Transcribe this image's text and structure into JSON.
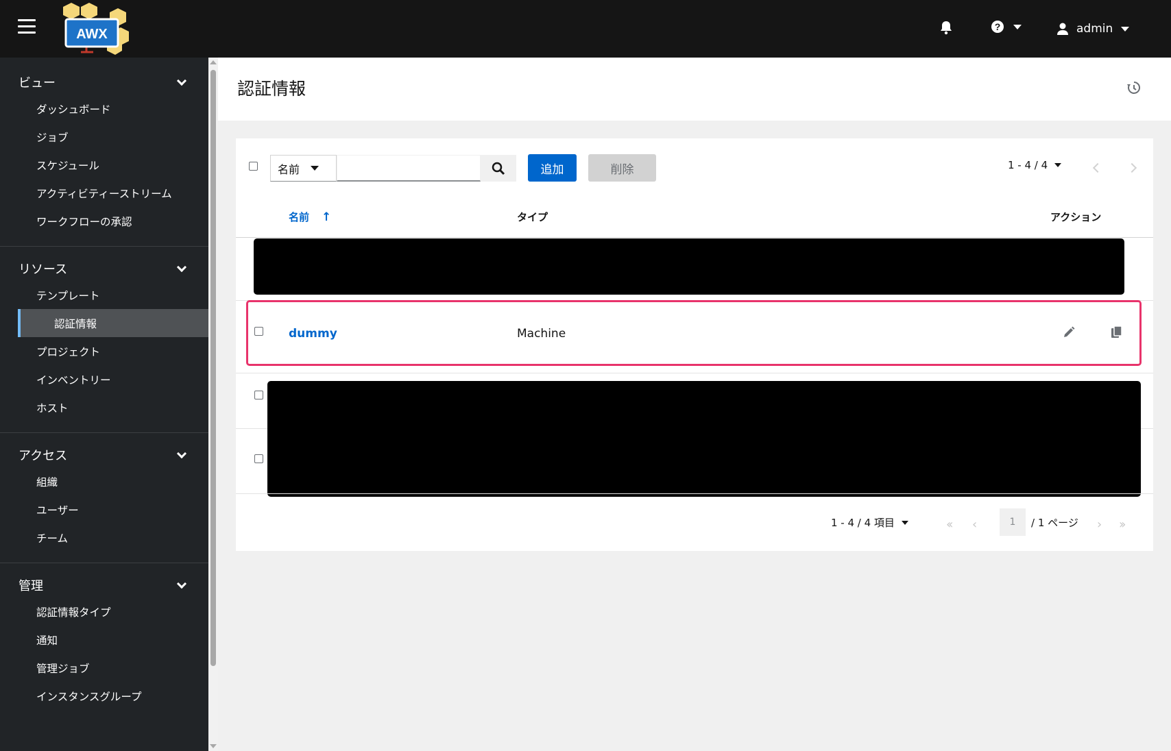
{
  "header": {
    "logo_text": "AWX",
    "user_name": "admin"
  },
  "sidebar": {
    "groups": [
      {
        "title": "ビュー",
        "items": [
          "ダッシュボード",
          "ジョブ",
          "スケジュール",
          "アクティビティーストリーム",
          "ワークフローの承認"
        ]
      },
      {
        "title": "リソース",
        "items": [
          "テンプレート",
          "認証情報",
          "プロジェクト",
          "インベントリー",
          "ホスト"
        ]
      },
      {
        "title": "アクセス",
        "items": [
          "組織",
          "ユーザー",
          "チーム"
        ]
      },
      {
        "title": "管理",
        "items": [
          "認証情報タイプ",
          "通知",
          "管理ジョブ",
          "インスタンスグループ"
        ]
      }
    ],
    "active_item": "認証情報"
  },
  "page": {
    "title": "認証情報"
  },
  "toolbar": {
    "filter_select": "名前",
    "add_label": "追加",
    "delete_label": "削除",
    "pager_top": "1 - 4 / 4"
  },
  "table": {
    "columns": {
      "name": "名前",
      "type": "タイプ",
      "actions": "アクション"
    },
    "rows": [
      {
        "name": "dummy",
        "type": "Machine"
      }
    ]
  },
  "pagination": {
    "items_label": "1 - 4 / 4 項目",
    "current_page": "1",
    "page_of": "/ 1 ページ"
  },
  "colors": {
    "accent": "#0066cc",
    "highlight": "#e8336b",
    "topbar": "#151515",
    "sidebar": "#212427"
  }
}
